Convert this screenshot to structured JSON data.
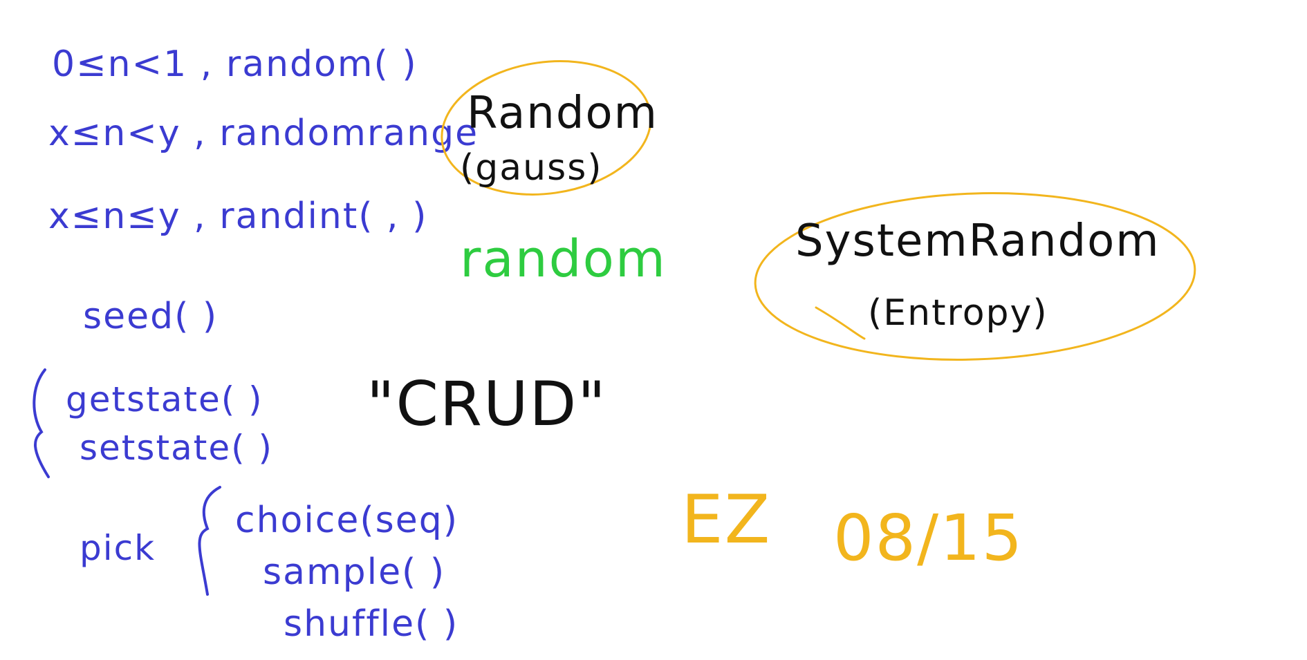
{
  "colors": {
    "background": "#ffffff",
    "blue": "#3b3bd1",
    "black": "#111111",
    "green": "#2ecc40",
    "orange": "#f2b51d"
  },
  "notes": {
    "line1": "0≤n<1 , random( )",
    "line2": "x≤n<y , randomrange",
    "line3": "x≤n≤y , randint( , )",
    "seed": "seed( )",
    "getstate": "getstate( )",
    "setstate": "setstate( )",
    "crud": "\"CRUD\"",
    "pick": "pick",
    "choice": "choice(seq)",
    "sample": "sample( )",
    "shuffle": "shuffle( )"
  },
  "random_group": {
    "title": "Random",
    "subtitle": "(gauss)"
  },
  "module": {
    "name": "random"
  },
  "system_random": {
    "title": "SystemRandom",
    "subtitle": "(Entropy)"
  },
  "signature": {
    "initials": "EZ",
    "date": "08/15"
  }
}
